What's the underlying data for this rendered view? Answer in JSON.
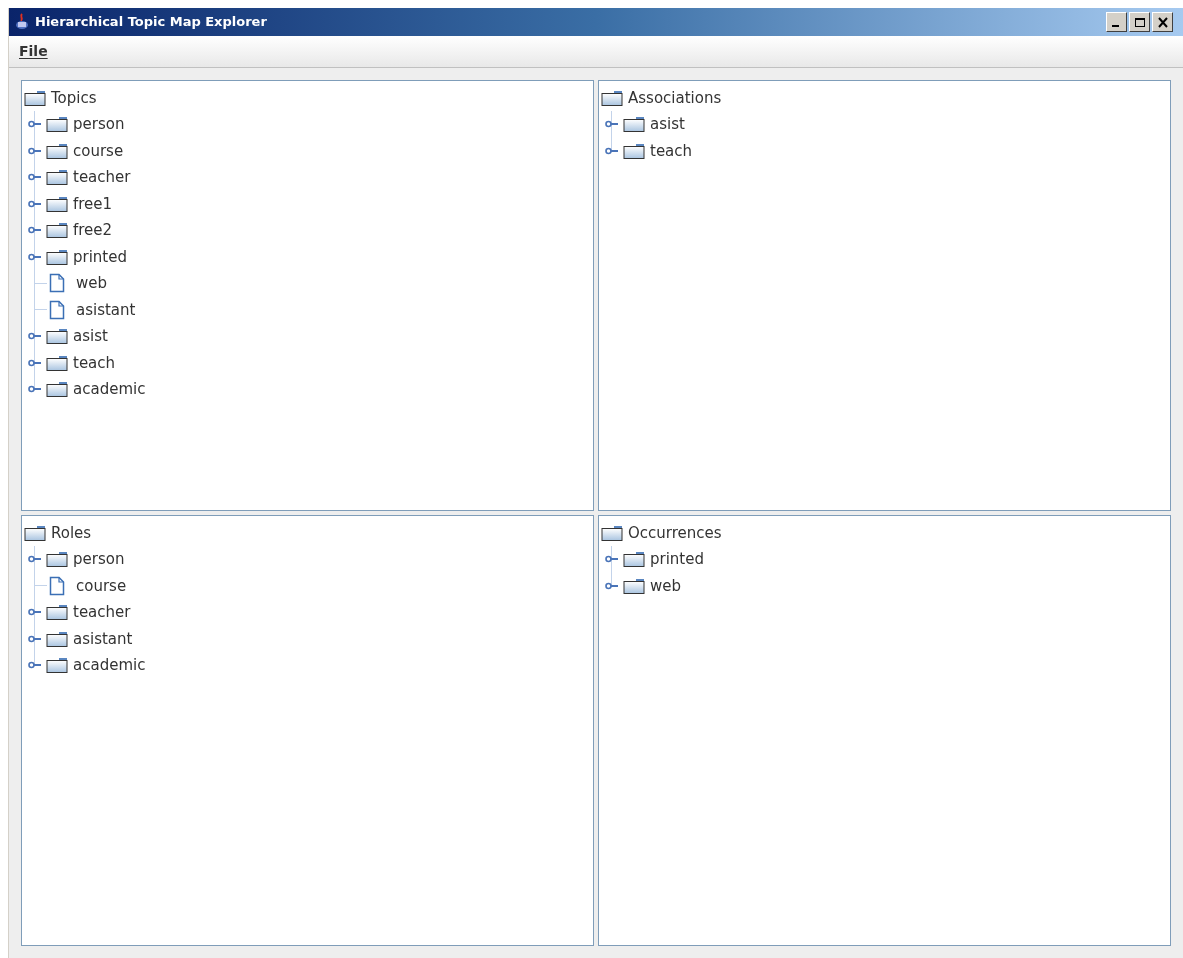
{
  "window": {
    "title": "Hierarchical Topic Map Explorer"
  },
  "menu": [
    {
      "label": "File"
    }
  ],
  "panels": [
    {
      "root": "Topics",
      "items": [
        {
          "label": "person",
          "kind": "folder"
        },
        {
          "label": "course",
          "kind": "folder"
        },
        {
          "label": "teacher",
          "kind": "folder"
        },
        {
          "label": "free1",
          "kind": "folder"
        },
        {
          "label": "free2",
          "kind": "folder"
        },
        {
          "label": "printed",
          "kind": "folder"
        },
        {
          "label": "web",
          "kind": "leaf"
        },
        {
          "label": "asistant",
          "kind": "leaf"
        },
        {
          "label": "asist",
          "kind": "folder"
        },
        {
          "label": "teach",
          "kind": "folder"
        },
        {
          "label": "academic",
          "kind": "folder"
        }
      ]
    },
    {
      "root": "Associations",
      "items": [
        {
          "label": "asist",
          "kind": "folder"
        },
        {
          "label": "teach",
          "kind": "folder"
        }
      ]
    },
    {
      "root": "Roles",
      "items": [
        {
          "label": "person",
          "kind": "folder"
        },
        {
          "label": "course",
          "kind": "leaf"
        },
        {
          "label": "teacher",
          "kind": "folder"
        },
        {
          "label": "asistant",
          "kind": "folder"
        },
        {
          "label": "academic",
          "kind": "folder"
        }
      ]
    },
    {
      "root": "Occurrences",
      "items": [
        {
          "label": "printed",
          "kind": "folder"
        },
        {
          "label": "web",
          "kind": "folder"
        }
      ]
    }
  ]
}
